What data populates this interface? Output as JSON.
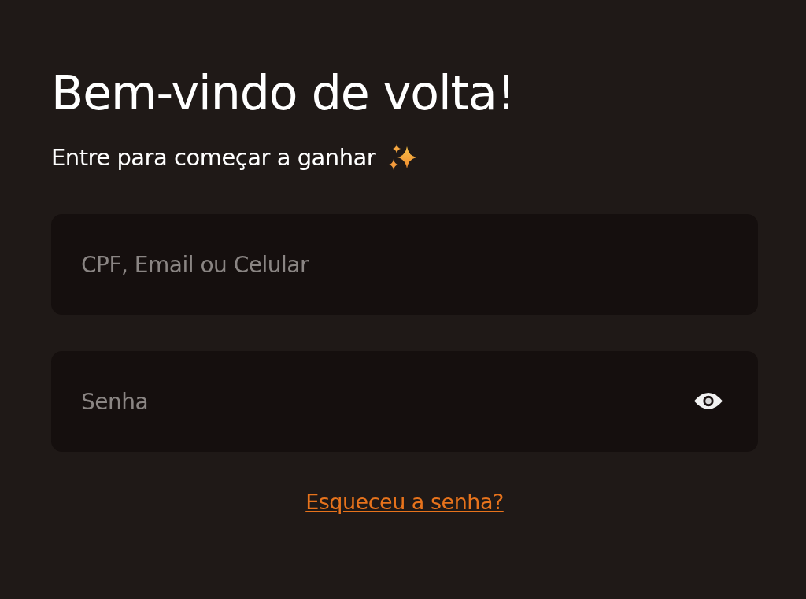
{
  "title": "Bem-vindo de volta!",
  "subtitle": "Entre para começar a ganhar",
  "fields": [
    {
      "kind": "text",
      "placeholder": "CPF, Email ou Celular"
    },
    {
      "kind": "password",
      "placeholder": "Senha"
    }
  ],
  "forgot_link": "Esqueceu a senha?"
}
